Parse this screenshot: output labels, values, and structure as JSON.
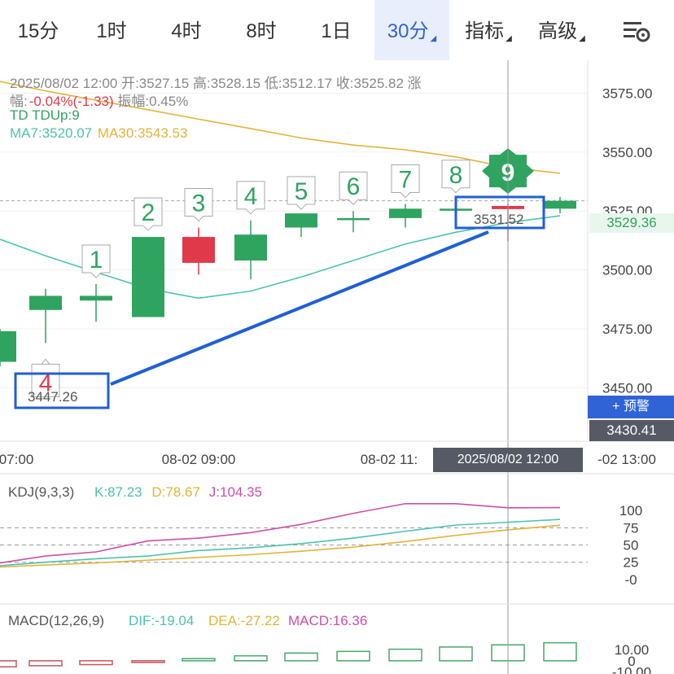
{
  "tabs": [
    {
      "label": "15分",
      "active": false,
      "caret": false
    },
    {
      "label": "1时",
      "active": false,
      "caret": false
    },
    {
      "label": "4时",
      "active": false,
      "caret": false
    },
    {
      "label": "8时",
      "active": false,
      "caret": false
    },
    {
      "label": "1日",
      "active": false,
      "caret": false
    },
    {
      "label": "30分",
      "active": true,
      "caret": true
    },
    {
      "label": "指标",
      "active": false,
      "caret": true
    },
    {
      "label": "高级",
      "active": false,
      "caret": true
    }
  ],
  "settings_icon": "chart-settings-icon",
  "info": {
    "line1": "2025/08/02 12:00 开:3527.15 高:3528.15 低:3512.17 收:3525.82 涨",
    "line2_prefix": "幅:",
    "line2_change": "-0.04%(-1.33)",
    "line2_suffix": " 振幅:0.45%",
    "td": "TD TDUp:9",
    "ma7": "MA7:3520.07",
    "ma30": "MA30:3543.53"
  },
  "colors": {
    "up": "#2fa360",
    "down": "#e0394a",
    "ma7": "#4cc2b0",
    "ma30": "#e2b43a",
    "accent": "#2f63d6",
    "k": "#4cc2b0",
    "d": "#e2b43a",
    "j": "#cc4fa6",
    "macd_neg": "#c9545e",
    "macd_pos": "#46a86a"
  },
  "price_tag": "3529.36",
  "alert_button": "+ 预警",
  "cursor_price": "3430.41",
  "cursor_time": "2025/08/02 12:00",
  "annotations": {
    "high_label": "3531.52",
    "low_label": "3447.26"
  },
  "chart_data": [
    {
      "type": "candlestick",
      "y_ticks": [
        "3575.00",
        "3550.00",
        "3525.00",
        "3500.00",
        "3475.00",
        "3450.00"
      ],
      "y_tick_values": [
        3575,
        3550,
        3525,
        3500,
        3475,
        3450
      ],
      "ylim": [
        3428,
        3589
      ],
      "x_ticks": [
        "07:00",
        "08-02 09:00",
        "08-02 11:",
        "-02 13:00"
      ],
      "candles": [
        {
          "o": 3461,
          "h": 3475,
          "l": 3459,
          "c": 3474
        },
        {
          "o": 3483,
          "h": 3492,
          "l": 3469,
          "c": 3489
        },
        {
          "o": 3487,
          "h": 3494,
          "l": 3478,
          "c": 3489
        },
        {
          "o": 3480,
          "h": 3514,
          "l": 3480,
          "c": 3514
        },
        {
          "o": 3514,
          "h": 3518,
          "l": 3498,
          "c": 3503
        },
        {
          "o": 3504,
          "h": 3521,
          "l": 3496,
          "c": 3515
        },
        {
          "o": 3518,
          "h": 3523,
          "l": 3514,
          "c": 3524
        },
        {
          "o": 3522,
          "h": 3525,
          "l": 3516,
          "c": 3522
        },
        {
          "o": 3522,
          "h": 3528,
          "l": 3518,
          "c": 3526
        },
        {
          "o": 3526,
          "h": 3530,
          "l": 3524,
          "c": 3526
        },
        {
          "o": 3527.15,
          "h": 3528.15,
          "l": 3512.17,
          "c": 3525.82
        },
        {
          "o": 3526,
          "h": 3531,
          "l": 3524,
          "c": 3529.36
        }
      ],
      "td_labels": [
        "",
        "4",
        "1",
        "2",
        "3",
        "4",
        "5",
        "6",
        "7",
        "8",
        "9",
        ""
      ],
      "td_colors": [
        "",
        "down",
        "up",
        "up",
        "up",
        "up",
        "up",
        "up",
        "up",
        "up",
        "up",
        ""
      ],
      "ma7": [
        3513,
        3506,
        3499,
        3492,
        3488,
        3491,
        3497,
        3504,
        3511,
        3516,
        3520.07,
        3523
      ],
      "ma30": [
        3580,
        3576,
        3572,
        3568,
        3564,
        3560,
        3556,
        3553,
        3551,
        3548,
        3543.53,
        3541
      ]
    },
    {
      "type": "line",
      "title": "KDJ(9,3,3)",
      "legend": [
        {
          "name": "K:87.23",
          "color": "k"
        },
        {
          "name": "D:78.67",
          "color": "d"
        },
        {
          "name": "J:104.35",
          "color": "j"
        }
      ],
      "y_ticks": [
        "100",
        "75",
        "50",
        "25",
        "-0"
      ],
      "y_tick_values": [
        100,
        75,
        50,
        25,
        0
      ],
      "ylim": [
        -12,
        118
      ],
      "series": [
        {
          "key": "k",
          "values": [
            20,
            25,
            30,
            34,
            42,
            46,
            52,
            60,
            70,
            79,
            83,
            87.23
          ]
        },
        {
          "key": "d",
          "values": [
            18,
            21,
            24,
            28,
            32,
            36,
            41,
            47,
            55,
            64,
            72,
            78.67
          ]
        },
        {
          "key": "j",
          "values": [
            24,
            34,
            40,
            56,
            60,
            68,
            80,
            96,
            110,
            110,
            104,
            104.35
          ]
        }
      ]
    },
    {
      "type": "bar",
      "title": "MACD(12,26,9)",
      "legend": [
        {
          "name": "DIF:-19.04",
          "color": "k"
        },
        {
          "name": "DEA:-27.22",
          "color": "d"
        },
        {
          "name": "MACD:16.36",
          "color": "j"
        }
      ],
      "y_ticks": [
        "10.00",
        "0",
        "-10.00"
      ],
      "y_tick_values": [
        10,
        0,
        -10
      ],
      "ylim": [
        -12,
        22
      ],
      "values": [
        -5.5,
        -4.5,
        -3.5,
        -0.5,
        2,
        4.5,
        7,
        8.5,
        10.5,
        12.5,
        14.5,
        16.36
      ]
    }
  ]
}
